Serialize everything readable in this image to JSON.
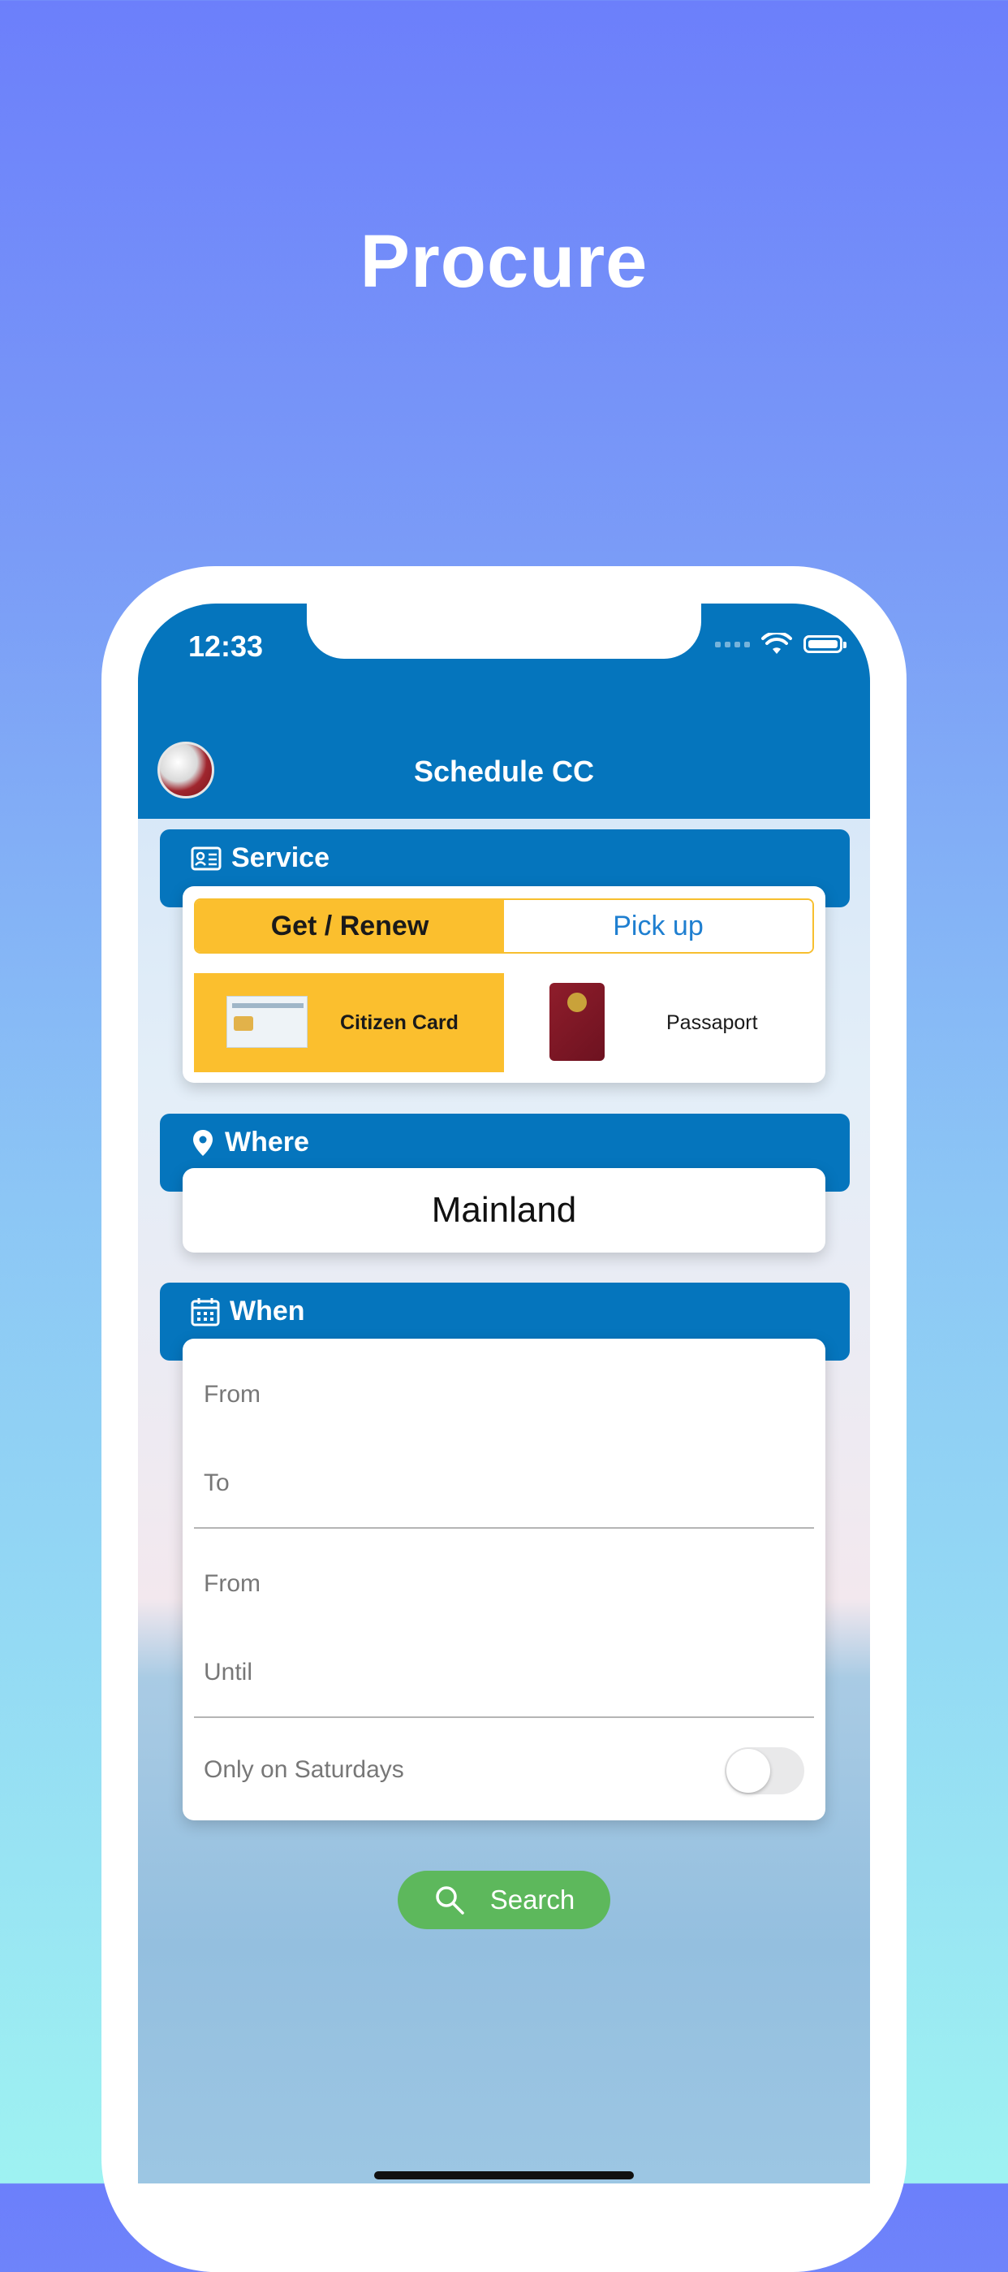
{
  "headline": "Procure",
  "status_bar": {
    "time": "12:33"
  },
  "nav": {
    "title": "Schedule CC"
  },
  "service": {
    "header": "Service",
    "segments": [
      {
        "label": "Get / Renew",
        "selected": true
      },
      {
        "label": "Pick up",
        "selected": false
      }
    ],
    "types": [
      {
        "label": "Citizen Card",
        "selected": true
      },
      {
        "label": "Passaport",
        "selected": false
      }
    ]
  },
  "where": {
    "header": "Where",
    "value": "Mainland"
  },
  "when": {
    "header": "When",
    "fields": [
      "From",
      "To",
      "From",
      "Until"
    ],
    "toggle_label": "Only on Saturdays",
    "toggle_on": false
  },
  "search_button": {
    "label": "Search"
  },
  "colors": {
    "primary_blue": "#0575bd",
    "accent_yellow": "#fbbf2e",
    "segment_text_blue": "#1f7fd0",
    "search_green": "#5db85c"
  }
}
